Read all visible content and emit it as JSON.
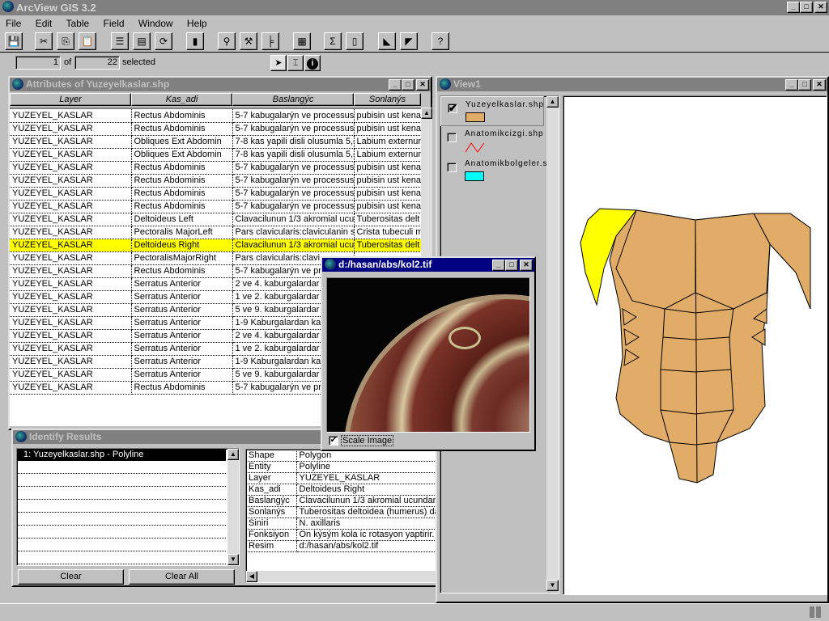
{
  "app": {
    "title": "ArcView GIS 3.2"
  },
  "menu": [
    "File",
    "Edit",
    "Table",
    "Field",
    "Window",
    "Help"
  ],
  "toolbar": {
    "icons": [
      "save-icon",
      "cut-icon",
      "copy-icon",
      "paste-icon",
      "table-properties-icon",
      "select-all-icon",
      "refresh-icon",
      "chart-icon",
      "find-icon",
      "query-icon",
      "sort-icon",
      "join-icon",
      "summarize-icon",
      "calculate-icon",
      "sort-ascending-icon",
      "sort-descending-icon",
      "help-icon"
    ]
  },
  "selection": {
    "selected": "1",
    "of_label": "of",
    "total": "22",
    "selected_label": "selected"
  },
  "attributes": {
    "title": "Attributes of Yuzeyelkaslar.shp",
    "columns": [
      "Layer",
      "Kas_adi",
      "Baslangýc",
      "Sonlanýs"
    ],
    "highlight_color": "#ffff00",
    "highlight_row": 10,
    "rows": [
      [
        "YUZEYEL_KASLAR",
        "Rectus Abdominis",
        "5-7 kabugalarýn ve processus",
        "pubisin ust kena"
      ],
      [
        "YUZEYEL_KASLAR",
        "Rectus Abdominis",
        "5-7 kabugalarýn ve processus",
        "pubisin ust kena"
      ],
      [
        "YUZEYEL_KASLAR",
        "Obliques Ext Abdomin",
        "7-8 kas yapili disli olusumla 5,(6",
        "Labium externun"
      ],
      [
        "YUZEYEL_KASLAR",
        "Obliques Ext Abdomin",
        "7-8 kas yapili disli olusumla 5,(6",
        "Labium externun"
      ],
      [
        "YUZEYEL_KASLAR",
        "Rectus Abdominis",
        "5-7 kabugalarýn ve processus",
        "pubisin ust kena"
      ],
      [
        "YUZEYEL_KASLAR",
        "Rectus Abdominis",
        "5-7 kabugalarýn ve processus",
        "pubisin ust kena"
      ],
      [
        "YUZEYEL_KASLAR",
        "Rectus Abdominis",
        "5-7 kabugalarýn ve processus",
        "pubisin ust kena"
      ],
      [
        "YUZEYEL_KASLAR",
        "Rectus Abdominis",
        "5-7 kabugalarýn ve processus",
        "pubisin ust kena"
      ],
      [
        "YUZEYEL_KASLAR",
        "Deltoideus Left",
        "Clavacilunun 1/3 akromial ucu",
        "Tuberositas delt"
      ],
      [
        "YUZEYEL_KASLAR",
        "Pectoralis MajorLeft",
        "Pars clavicularis:claviculanin st",
        "Crista tubeculi m"
      ],
      [
        "YUZEYEL_KASLAR",
        "Deltoideus Right",
        "Clavacilunun 1/3 akromial ucu",
        "Tuberositas delt"
      ],
      [
        "YUZEYEL_KASLAR",
        "PectoralisMajorRight",
        "Pars clavicularis:clavi",
        ""
      ],
      [
        "YUZEYEL_KASLAR",
        "Rectus Abdominis",
        "5-7 kabugalarýn ve pr",
        ""
      ],
      [
        "YUZEYEL_KASLAR",
        "Serratus Anterior",
        "2 ve 4. kaburgalardar",
        ""
      ],
      [
        "YUZEYEL_KASLAR",
        "Serratus Anterior",
        "1 ve 2. kaburgalardar",
        ""
      ],
      [
        "YUZEYEL_KASLAR",
        "Serratus Anterior",
        "5 ve 9. kaburgalardar",
        ""
      ],
      [
        "YUZEYEL_KASLAR",
        "Serratus Anterior",
        "1-9 Kaburgalardan ka",
        ""
      ],
      [
        "YUZEYEL_KASLAR",
        "Serratus Anterior",
        "2 ve 4. kaburgalardar",
        ""
      ],
      [
        "YUZEYEL_KASLAR",
        "Serratus Anterior",
        "1 ve 2. kaburgalardar",
        ""
      ],
      [
        "YUZEYEL_KASLAR",
        "Serratus Anterior",
        "1-9 Kaburgalardan ka",
        ""
      ],
      [
        "YUZEYEL_KASLAR",
        "Serratus Anterior",
        "5 ve 9. kaburgalardar",
        ""
      ],
      [
        "YUZEYEL_KASLAR",
        "Rectus Abdominis",
        "5-7 kabugalarýn ve pr",
        ""
      ]
    ]
  },
  "identify": {
    "title": "Identify Results",
    "results": [
      "1:  Yuzeyelkaslar.shp - Polyline"
    ],
    "fields": [
      [
        "Shape",
        "Polygon"
      ],
      [
        "Entity",
        "Polyline"
      ],
      [
        "Layer",
        "YUZEYEL_KASLAR"
      ],
      [
        "Kas_adi",
        "Deltoideus Right"
      ],
      [
        "Baslangýc",
        "Clavacilunun 1/3 akromial ucundan, acremion2den v"
      ],
      [
        "Sonlanýs",
        "Tuberositas deltoidea (humerus) da"
      ],
      [
        "Siniri",
        "N. axillaris"
      ],
      [
        "Fonksiyon",
        "On kýsým kola ic rotasyon yaptirir. One ceker,orta kýs"
      ],
      [
        "Resim",
        "d:/hasan/abs/kol2.tif"
      ]
    ],
    "clear_label": "Clear",
    "clear_all_label": "Clear All"
  },
  "image_window": {
    "title": "d:/hasan/abs/kol2.tif",
    "scale_label": "Scale Image",
    "scale_checked": true
  },
  "view": {
    "title": "View1",
    "themes": [
      {
        "name": "Yuzeyelkaslar.shp",
        "checked": true,
        "symbol": "fill",
        "color": "#e0ac68"
      },
      {
        "name": "Anatomikcizgi.shp",
        "checked": false,
        "symbol": "line",
        "color": "#ff0000"
      },
      {
        "name": "Anatomikbolgeler.s",
        "checked": false,
        "symbol": "fill",
        "color": "#00ffff"
      }
    ],
    "selected_color": "#ffff00"
  }
}
